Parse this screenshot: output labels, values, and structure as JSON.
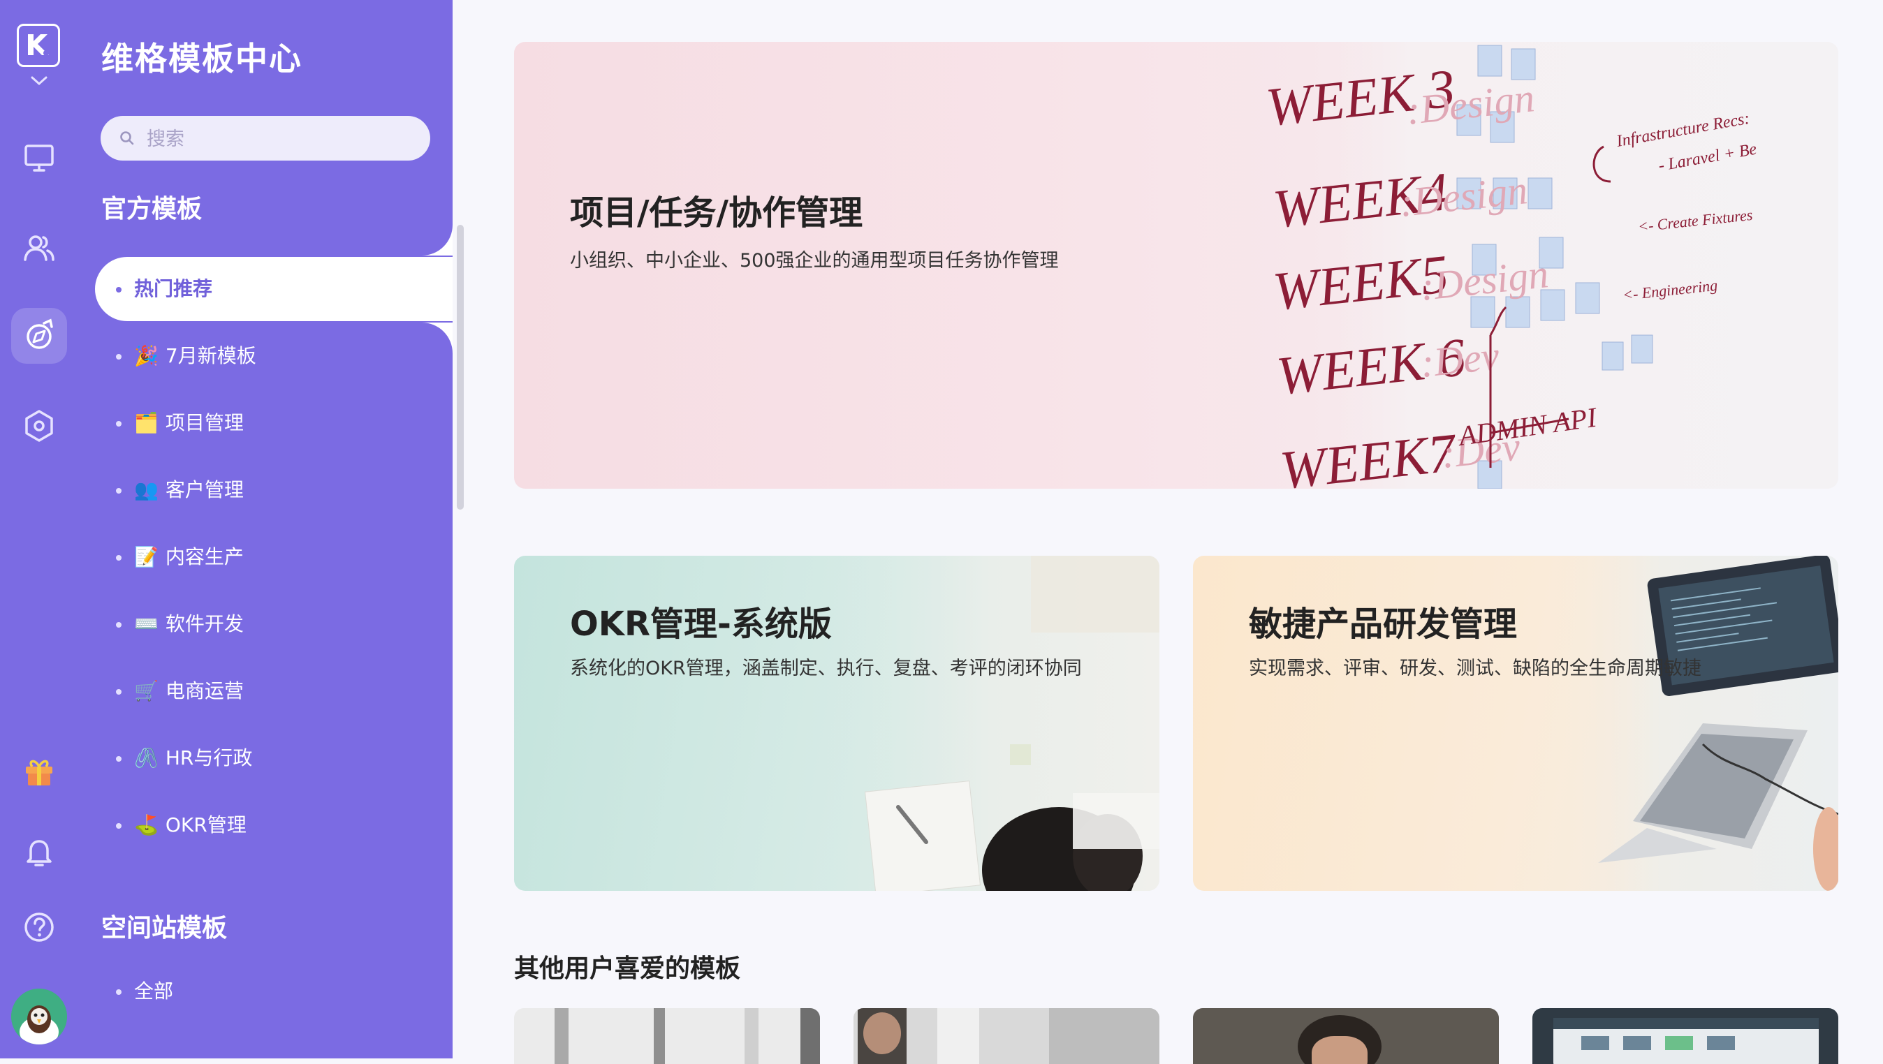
{
  "rail": {
    "icons": [
      "logo-icon",
      "monitor-icon",
      "users-icon",
      "explore-icon",
      "settings-hex-icon",
      "gift-icon",
      "bell-icon",
      "help-icon"
    ]
  },
  "sidebar": {
    "title": "维格模板中心",
    "search_placeholder": "搜索",
    "official_title": "官方模板",
    "items": [
      {
        "emoji": "",
        "label": "热门推荐"
      },
      {
        "emoji": "🎉",
        "label": "7月新模板"
      },
      {
        "emoji": "🗂️",
        "label": "项目管理"
      },
      {
        "emoji": "👥",
        "label": "客户管理"
      },
      {
        "emoji": "📝",
        "label": "内容生产"
      },
      {
        "emoji": "⌨️",
        "label": "软件开发"
      },
      {
        "emoji": "🛒",
        "label": "电商运营"
      },
      {
        "emoji": "🖇️",
        "label": "HR与行政"
      },
      {
        "emoji": "⛳",
        "label": "OKR管理"
      }
    ],
    "space_title": "空间站模板",
    "space_items": [
      {
        "label": "全部"
      }
    ]
  },
  "main": {
    "hero": {
      "title": "项目/任务/协作管理",
      "desc": "小组织、中小企业、500强企业的通用型项目任务协作管理",
      "board": {
        "weeks": [
          "WEEK 3",
          "WEEK4",
          "WEEK5",
          "WEEK 6",
          "WEEK7"
        ],
        "phases": [
          ":Design",
          ":Design",
          ":Design",
          ":Dev",
          ":Dev"
        ],
        "notes": [
          "Infrastructure Recs:",
          "- Laravel + Be",
          "<- Create Fixtures",
          "<- Engineering",
          "ADMIN  API"
        ]
      }
    },
    "okr": {
      "title": "OKR管理-系统版",
      "desc": "系统化的OKR管理，涵盖制定、执行、复盘、考评的闭环协同"
    },
    "agile": {
      "title": "敏捷产品研发管理",
      "desc": "实现需求、评审、研发、测试、缺陷的全生命周期敏捷"
    },
    "others_title": "其他用户喜爱的模板"
  },
  "colors": {
    "brand": "#7b6be3",
    "active_text": "#7060da",
    "board_ink": "#8c1d36"
  }
}
